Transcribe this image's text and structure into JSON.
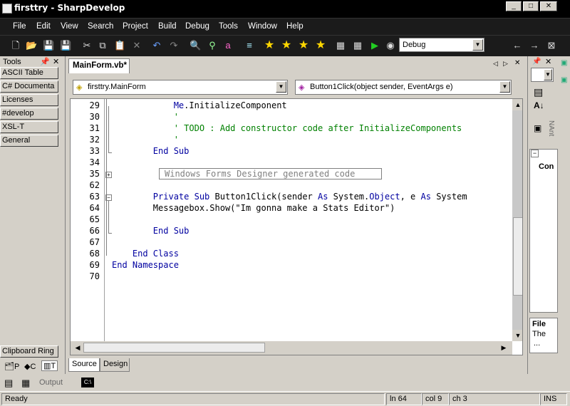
{
  "window": {
    "title": "firsttry - SharpDevelop"
  },
  "menu": [
    "File",
    "Edit",
    "View",
    "Search",
    "Project",
    "Build",
    "Debug",
    "Tools",
    "Window",
    "Help"
  ],
  "toolbar": {
    "config_value": "Debug"
  },
  "tools_panel": {
    "title": "Tools",
    "categories": [
      "ASCII Table",
      "C# Documenta",
      "Licenses",
      "#develop",
      "XSL-T",
      "General"
    ],
    "clipboard_ring": "Clipboard Ring",
    "tab_labels": [
      "P",
      "C",
      "T"
    ]
  },
  "document": {
    "tab_label": "MainForm.vb*",
    "class_combo": "firsttry.MainForm",
    "member_combo": "Button1Click(object sender, EventArgs e)",
    "view_tabs": [
      "Source",
      "Design"
    ]
  },
  "code_lines": [
    {
      "num": "29",
      "parts": [
        {
          "t": "            "
        },
        {
          "t": "Me",
          "c": "kw"
        },
        {
          "t": ".InitializeComponent"
        }
      ]
    },
    {
      "num": "30",
      "parts": [
        {
          "t": "            "
        },
        {
          "t": "'",
          "c": "cm"
        }
      ]
    },
    {
      "num": "31",
      "parts": [
        {
          "t": "            "
        },
        {
          "t": "' TODO : Add constructor code after InitializeComponents",
          "c": "cm"
        }
      ]
    },
    {
      "num": "32",
      "parts": [
        {
          "t": "            "
        },
        {
          "t": "'",
          "c": "cm"
        }
      ]
    },
    {
      "num": "33",
      "parts": [
        {
          "t": "        "
        },
        {
          "t": "End Sub",
          "c": "kw"
        }
      ]
    },
    {
      "num": "34",
      "parts": []
    },
    {
      "num": "35",
      "parts": []
    },
    {
      "num": "62",
      "parts": []
    },
    {
      "num": "63",
      "parts": [
        {
          "t": "        "
        },
        {
          "t": "Private Sub",
          "c": "kw"
        },
        {
          "t": " Button1Click(sender "
        },
        {
          "t": "As",
          "c": "kw"
        },
        {
          "t": " System."
        },
        {
          "t": "Object",
          "c": "kw"
        },
        {
          "t": ", e "
        },
        {
          "t": "As",
          "c": "kw"
        },
        {
          "t": " System"
        }
      ]
    },
    {
      "num": "64",
      "parts": [
        {
          "t": "        Messagebox.Show(\"Im gonna make a Stats Editor\")"
        }
      ]
    },
    {
      "num": "65",
      "parts": []
    },
    {
      "num": "66",
      "parts": [
        {
          "t": "        "
        },
        {
          "t": "End Sub",
          "c": "kw"
        }
      ]
    },
    {
      "num": "67",
      "parts": []
    },
    {
      "num": "68",
      "parts": [
        {
          "t": "    "
        },
        {
          "t": "End Class",
          "c": "kw"
        }
      ]
    },
    {
      "num": "69",
      "parts": [
        {
          "t": ""
        },
        {
          "t": "End Namespace",
          "c": "kw"
        }
      ]
    },
    {
      "num": "70",
      "parts": []
    }
  ],
  "region_label": "Windows Forms Designer generated code",
  "right_panel": {
    "vertical_label": "NAnt",
    "section_label": "Con",
    "file_title": "File",
    "file_text": "The",
    "ellipsis": "..."
  },
  "output": {
    "label": "Output"
  },
  "status": {
    "ready": "Ready",
    "line": "ln 64",
    "col": "col 9",
    "ch": "ch 3",
    "mode": "INS"
  }
}
